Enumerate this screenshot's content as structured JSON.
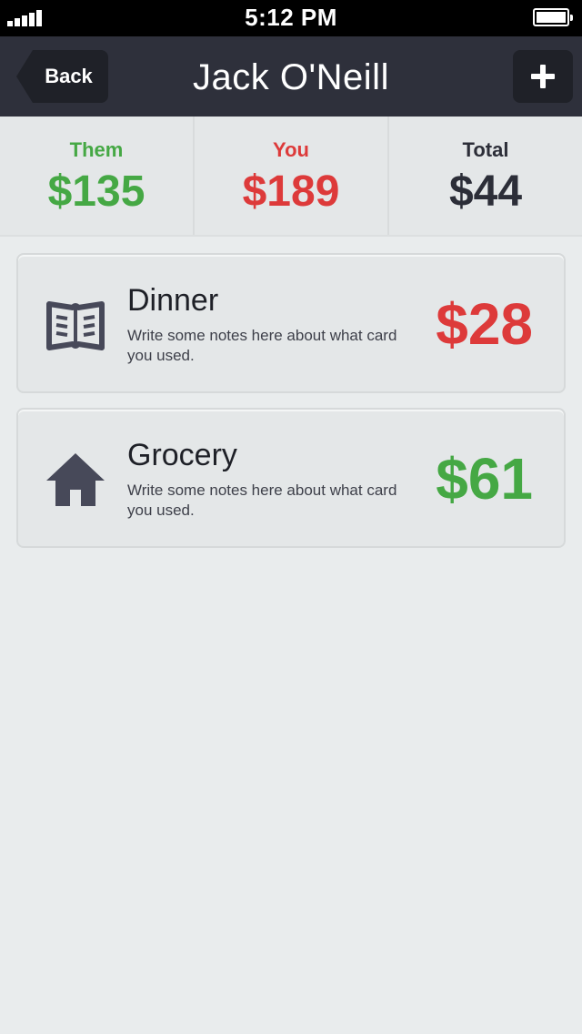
{
  "status_bar": {
    "time": "5:12 PM",
    "signal_icon": "signal-bars-icon",
    "battery_icon": "battery-full-icon"
  },
  "nav": {
    "back_label": "Back",
    "title": "Jack O'Neill",
    "add_icon": "plus-icon"
  },
  "summary": {
    "them": {
      "label": "Them",
      "value": "$135",
      "color": "#45a844"
    },
    "you": {
      "label": "You",
      "value": "$189",
      "color": "#dd3a3a"
    },
    "total": {
      "label": "Total",
      "value": "$44",
      "color": "#2c2e38"
    }
  },
  "transactions": [
    {
      "icon": "book-icon",
      "title": "Dinner",
      "notes": "Write some notes here about what card you used.",
      "amount": "$28",
      "amount_color": "#dd3a3a"
    },
    {
      "icon": "house-icon",
      "title": "Grocery",
      "notes": "Write some notes here about what card you used.",
      "amount": "$61",
      "amount_color": "#45a844"
    }
  ]
}
